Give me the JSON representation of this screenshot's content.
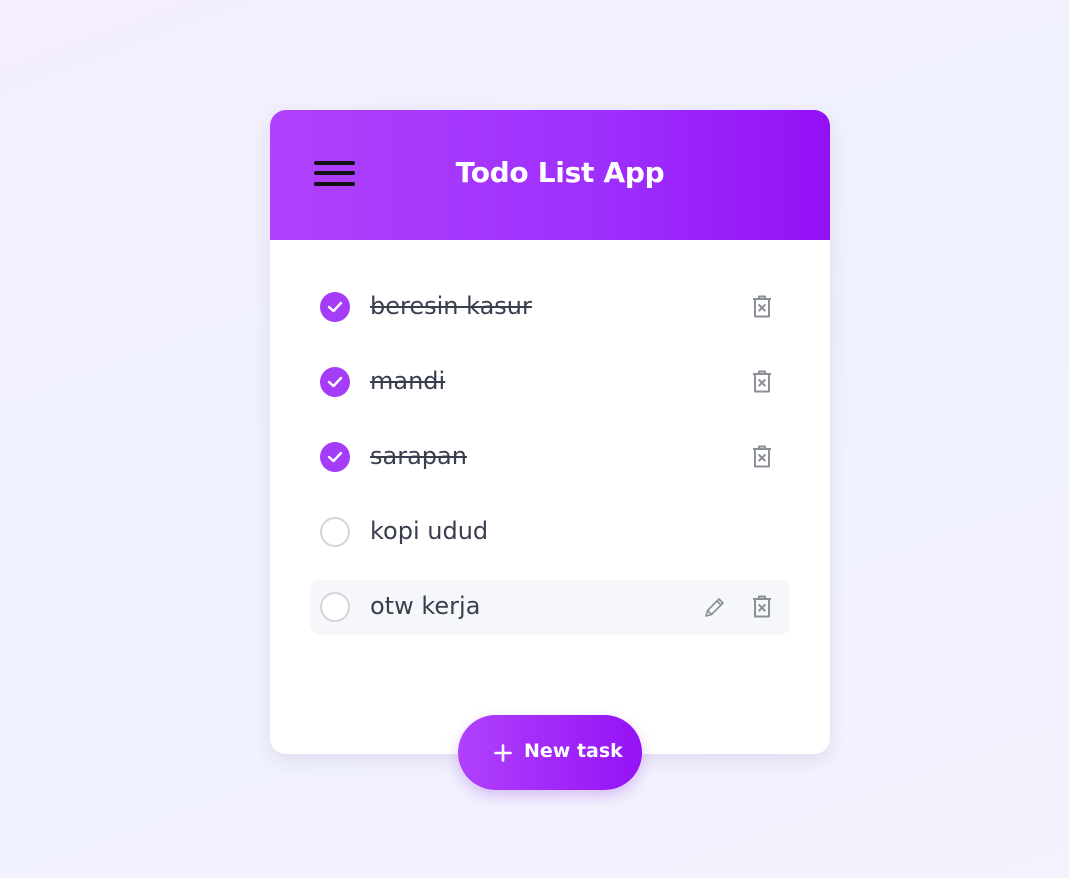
{
  "app": {
    "title": "Todo List App"
  },
  "colors": {
    "accent": "#a53cf8",
    "header_start": "#b041fc",
    "header_end": "#9410f5",
    "text": "#3a3f4e",
    "icon_gray": "#8b8f98"
  },
  "header": {
    "menu_icon": "hamburger-menu-icon"
  },
  "todos": [
    {
      "text": "beresin kasur",
      "completed": true,
      "actions": [
        "trash-icon"
      ]
    },
    {
      "text": "mandi",
      "completed": true,
      "actions": [
        "trash-icon"
      ]
    },
    {
      "text": "sarapan",
      "completed": true,
      "actions": [
        "trash-icon"
      ]
    },
    {
      "text": "kopi udud",
      "completed": false,
      "actions": []
    },
    {
      "text": "otw kerja",
      "completed": false,
      "hovered": true,
      "actions": [
        "pencil-icon",
        "trash-icon"
      ]
    }
  ],
  "fab": {
    "label": "New task",
    "icon": "plus-icon"
  }
}
